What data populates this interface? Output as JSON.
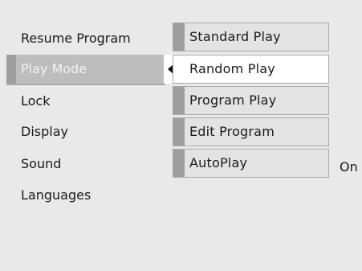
{
  "left_menu": {
    "items": [
      {
        "label": "Resume Program"
      },
      {
        "label": "Play Mode",
        "selected": true
      },
      {
        "label": "Lock"
      },
      {
        "label": "Display"
      },
      {
        "label": "Sound"
      },
      {
        "label": "Languages"
      }
    ]
  },
  "submenu": {
    "items": [
      {
        "label": "Standard Play"
      },
      {
        "label": "Random Play",
        "active": true
      },
      {
        "label": "Program Play"
      },
      {
        "label": "Edit Program"
      },
      {
        "label": "AutoPlay"
      }
    ]
  },
  "autoplay_value": "On",
  "colors": {
    "background": "#e9e9e9",
    "selected": "#bdbdbd",
    "stripe": "#9e9e9e",
    "active": "#ffffff"
  },
  "icons": {
    "pointer": "triangle-left-icon"
  }
}
